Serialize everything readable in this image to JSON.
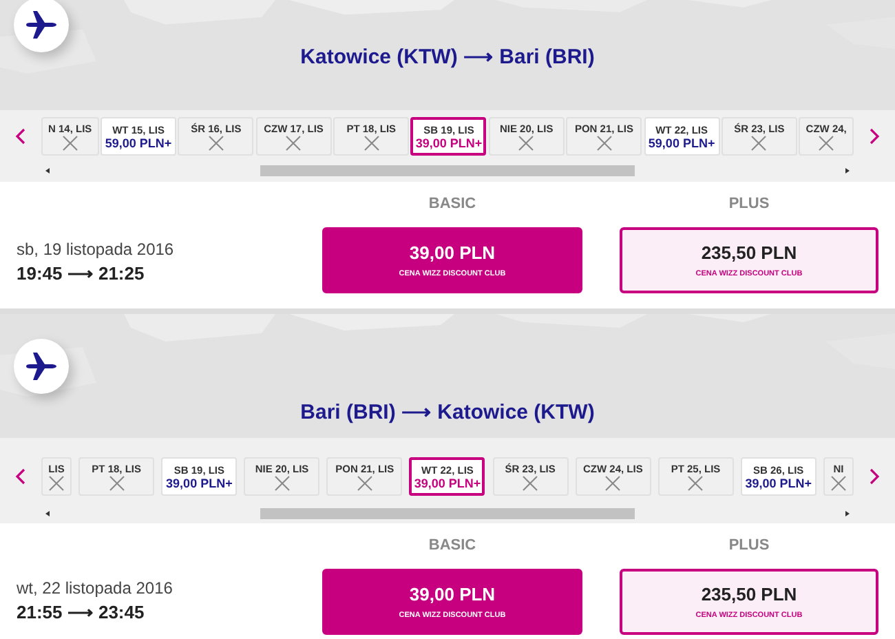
{
  "flights": [
    {
      "route": "Katowice (KTW) ⟶ Bari (BRI)",
      "dates": [
        {
          "label": "N 14, LIS",
          "kind": "none",
          "selected": false
        },
        {
          "label": "WT 15, LIS",
          "kind": "price",
          "price": "59,00 PLN+",
          "selected": false
        },
        {
          "label": "ŚR 16, LIS",
          "kind": "none",
          "selected": false
        },
        {
          "label": "CZW 17, LIS",
          "kind": "none",
          "selected": false
        },
        {
          "label": "PT 18, LIS",
          "kind": "none",
          "selected": false
        },
        {
          "label": "SB 19, LIS",
          "kind": "price",
          "price": "39,00 PLN+",
          "selected": true
        },
        {
          "label": "NIE 20, LIS",
          "kind": "none",
          "selected": false
        },
        {
          "label": "PON 21, LIS",
          "kind": "none",
          "selected": false
        },
        {
          "label": "WT 22, LIS",
          "kind": "price",
          "price": "59,00 PLN+",
          "selected": false
        },
        {
          "label": "ŚR 23, LIS",
          "kind": "none",
          "selected": false
        },
        {
          "label": "CZW 24,",
          "kind": "none",
          "selected": false
        }
      ],
      "date": "sb, 19 listopada 2016",
      "times": "19:45 ⟶ 21:25",
      "fares": [
        {
          "name": "BASIC",
          "price": "39,00 PLN",
          "note": "CENA WIZZ DISCOUNT CLUB",
          "kind": "filled"
        },
        {
          "name": "PLUS",
          "price": "235,50 PLN",
          "note": "CENA WIZZ DISCOUNT CLUB",
          "kind": "outline"
        }
      ]
    },
    {
      "route": "Bari (BRI) ⟶ Katowice (KTW)",
      "dates": [
        {
          "label": "LIS",
          "kind": "none",
          "selected": false
        },
        {
          "label": "PT 18, LIS",
          "kind": "none",
          "selected": false
        },
        {
          "label": "SB 19, LIS",
          "kind": "price",
          "price": "39,00 PLN+",
          "selected": false
        },
        {
          "label": "NIE 20, LIS",
          "kind": "none",
          "selected": false
        },
        {
          "label": "PON 21, LIS",
          "kind": "none",
          "selected": false
        },
        {
          "label": "WT 22, LIS",
          "kind": "price",
          "price": "39,00 PLN+",
          "selected": true
        },
        {
          "label": "ŚR 23, LIS",
          "kind": "none",
          "selected": false
        },
        {
          "label": "CZW 24, LIS",
          "kind": "none",
          "selected": false
        },
        {
          "label": "PT 25, LIS",
          "kind": "none",
          "selected": false
        },
        {
          "label": "SB 26, LIS",
          "kind": "price",
          "price": "39,00 PLN+",
          "selected": false
        },
        {
          "label": "NI",
          "kind": "none",
          "selected": false
        }
      ],
      "date": "wt, 22 listopada 2016",
      "times": "21:55 ⟶ 23:45",
      "fares": [
        {
          "name": "BASIC",
          "price": "39,00 PLN",
          "note": "CENA WIZZ DISCOUNT CLUB",
          "kind": "filled"
        },
        {
          "name": "PLUS",
          "price": "235,50 PLN",
          "note": "CENA WIZZ DISCOUNT CLUB",
          "kind": "outline"
        }
      ]
    }
  ]
}
